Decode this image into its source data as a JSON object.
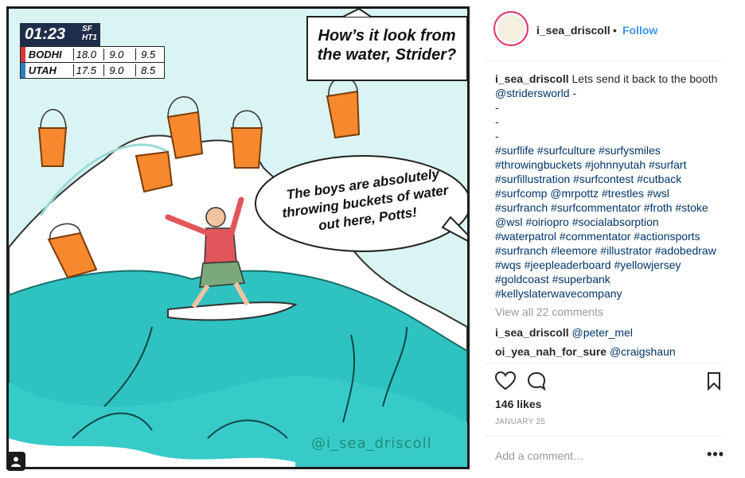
{
  "post": {
    "username": "i_sea_driscoll",
    "dot": "•",
    "follow_label": "Follow",
    "caption_user": "i_sea_driscoll",
    "caption_text": "Lets send it back to the booth",
    "caption_mention": "@stridersworld",
    "caption_mention_suffix": " -",
    "dash1": "-",
    "dash2": "-",
    "dash3": "-",
    "hashtag_lines": [
      "#surflife #surfculture #surfysmiles",
      "#throwingbuckets #johnnyutah #surfart",
      "#surfillustration #surfcontest #cutback",
      "#surfcomp @mrpottz #trestles #wsl",
      "#surfranch #surfcommentator #froth #stoke",
      "@wsl #oiriopro #socialabsorption",
      "#waterpatrol #commentator #actionsports",
      "#surfranch #leemore #illustrator #adobedraw",
      "#wqs #jeepleaderboard #yellowjersey",
      "#goldcoast #superbank",
      "#kellyslaterwavecompany"
    ],
    "view_all": "View all 22 comments",
    "comments": [
      {
        "user": "i_sea_driscoll",
        "text": "@peter_mel"
      },
      {
        "user": "oi_yea_nah_for_sure",
        "text": "@craigshaun"
      }
    ],
    "likes": "146 likes",
    "date": "JANUARY 25",
    "add_comment_placeholder": "Add a comment…",
    "more_label": "•••"
  },
  "comic": {
    "clock": "01:23",
    "heat_line1": "SF",
    "heat_line2": "HT1",
    "rows": [
      {
        "name": "BODHI",
        "color": "#d5383b",
        "total": "18.0",
        "s1": "9.0",
        "s2": "9.5"
      },
      {
        "name": "UTAH",
        "color": "#2e7fbf",
        "total": "17.5",
        "s1": "9.0",
        "s2": "8.5"
      }
    ],
    "bubble_top_line1": "How’s it look from",
    "bubble_top_line2": "the water, Strider?",
    "bubble_mid_line1": "The boys are absolutely",
    "bubble_mid_line2": "throwing buckets of water",
    "bubble_mid_line3": "out here, Potts!",
    "signature": "@i_sea_driscoll"
  },
  "colors": {
    "accent_link": "#003569",
    "follow": "#3897f0",
    "wave": "#2ec2c0",
    "bucket": "#f6882d"
  },
  "icons": [
    "heart-icon",
    "comment-icon",
    "bookmark-icon",
    "user-tag-icon",
    "more-icon"
  ]
}
